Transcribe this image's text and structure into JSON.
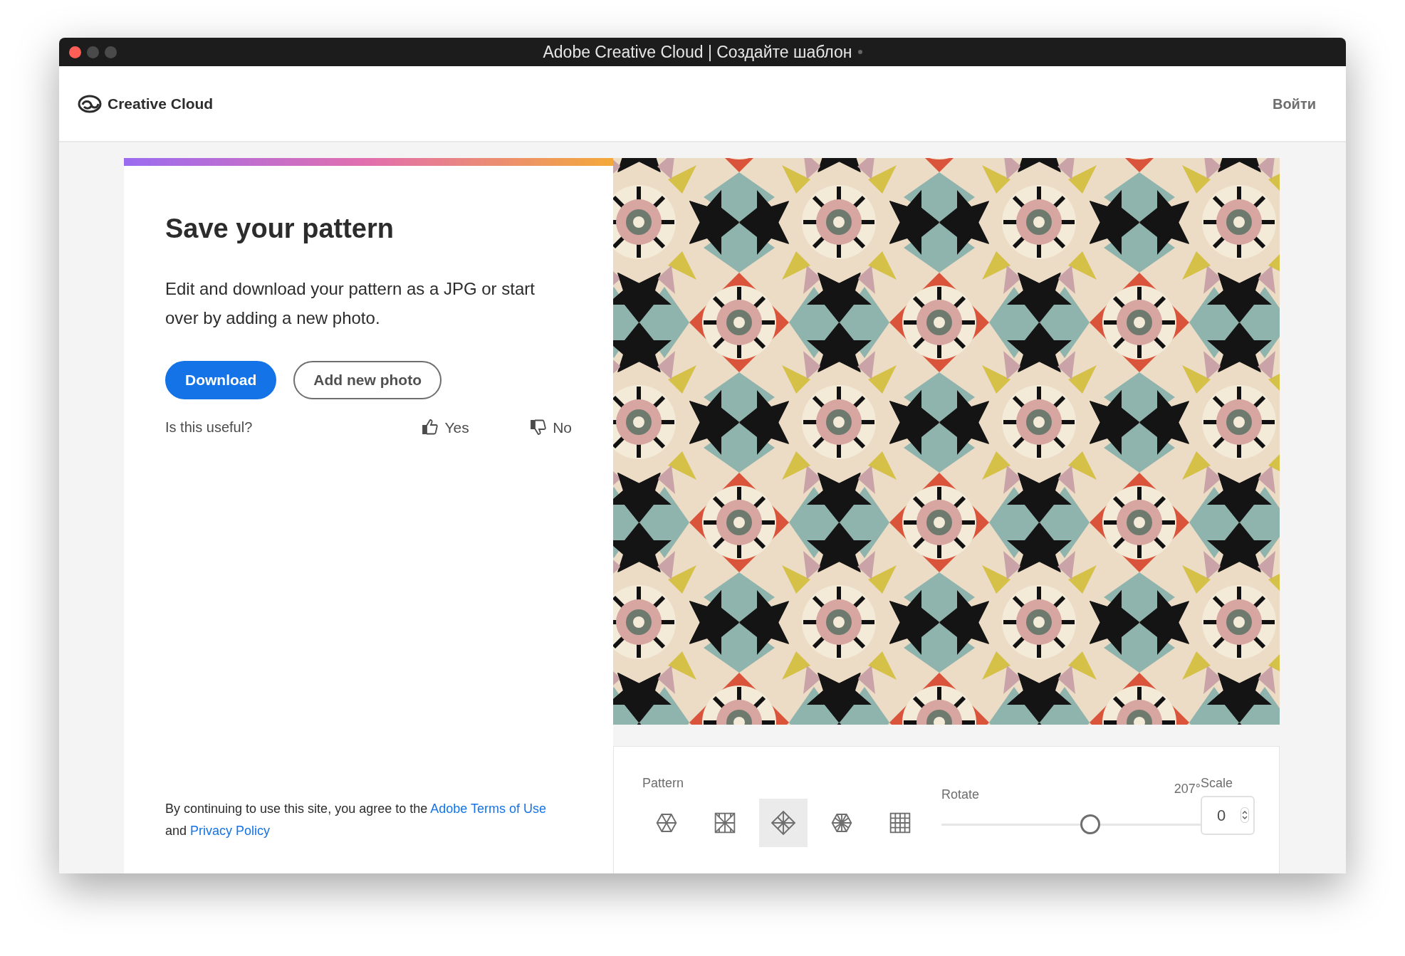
{
  "window": {
    "title": "Adobe Creative Cloud | Создайте шаблон"
  },
  "header": {
    "brand": "Creative Cloud",
    "sign_in": "Войти"
  },
  "panel": {
    "title": "Save your pattern",
    "description": "Edit and download your pattern as a JPG or start over by adding a new photo.",
    "buttons": [
      {
        "label": "Download",
        "kind": "primary"
      },
      {
        "label": "Add new photo",
        "kind": "outline"
      }
    ],
    "feedback": {
      "question": "Is this useful?",
      "options": [
        {
          "label": "Yes",
          "kind": "up"
        },
        {
          "label": "No",
          "kind": "down"
        }
      ]
    },
    "legal": [
      {
        "kind": "text",
        "text": "By continuing to use this site, you agree to the"
      },
      {
        "kind": "link",
        "text": "Adobe Terms of Use"
      },
      {
        "kind": "text",
        "text": "and"
      },
      {
        "kind": "link",
        "text": "Privacy Policy"
      }
    ]
  },
  "controls": {
    "pattern": {
      "label": "Pattern",
      "options": [
        {
          "kind": "hexagon",
          "selected": false
        },
        {
          "kind": "square",
          "selected": false
        },
        {
          "kind": "diamond",
          "selected": true
        },
        {
          "kind": "star",
          "selected": false
        },
        {
          "kind": "grid",
          "selected": false
        }
      ]
    },
    "rotate": {
      "label": "Rotate",
      "level": 0.575,
      "reading": "207°"
    },
    "scale": {
      "label": "Scale",
      "value": "0"
    }
  }
}
